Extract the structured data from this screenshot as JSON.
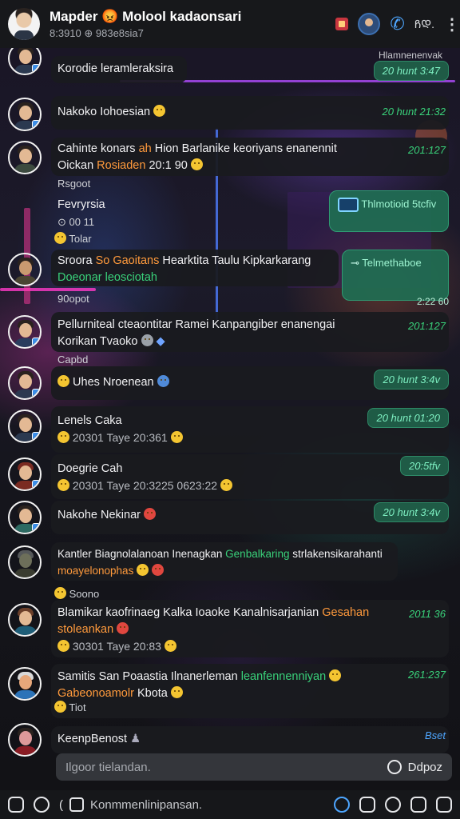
{
  "header": {
    "title": "Mapder 😡 Molool kadaonsari",
    "subtitle": "8:3910 ⊕ 983e8sia7",
    "video_label": "ᲩᲓ.",
    "menu": "⋮"
  },
  "top_strip": {
    "right_text": "Hlamnenenvak"
  },
  "messages": [
    {
      "text": "Korodie leramleraksira",
      "time": "20 hunt 3:47"
    },
    {
      "text": "Nakoko Iohoesian",
      "time": "20 hunt 21:32"
    },
    {
      "line1_a": "Cahinte konars ",
      "line1_b": "ah",
      "line1_c": " Hion Barlanike keoriyans enanennit",
      "line2_a": "Oickan ",
      "line2_b": "Rosiaden",
      "line2_c": " 20:1 90",
      "time": "201:127"
    },
    {
      "label": "Rsgoot",
      "title": "Fevryrsia",
      "sub": "⊙ 00 11",
      "react": "Tolar",
      "card": "Thlmotioid 5tcfiv"
    },
    {
      "line1_a": "Sroora ",
      "line1_b": "So Gaoitans",
      "line1_c": " Hearktita Taulu Kipkarkarang",
      "line2": "Doeonar leosciotah",
      "label": "90opot",
      "card": "Telmethaboe",
      "card_time": "2:22 60"
    },
    {
      "line1": "Pellurniteal cteaontitar Ramei Kanpangiber enanengai",
      "line2": "Korikan Tvaoko",
      "label": "Capbd",
      "time": "201:127"
    },
    {
      "text": "Uhes Nroenean",
      "time": "20 hunt 3:4v"
    },
    {
      "title": "Lenels Caka",
      "sub": "20301 Taye  20:361",
      "time": "20 hunt 01:20"
    },
    {
      "title": "Doegrie Cah",
      "sub": "20301 Taye  20:3225  0623:22",
      "time": "20:5tfv"
    },
    {
      "text": "Nakohe Nekinar",
      "time": "20 hunt 3:4v"
    },
    {
      "line1_a": "Kantler Biagnolalanoan Inenagkan ",
      "line1_b": "Genbalkaring",
      "line1_c": " strlakensikarahanti",
      "line2": "moayelonophas",
      "react": "Soono"
    },
    {
      "line1_a": "Blamikar kaofrinaeg Kalka Ioaoke Kanalnisarjanian ",
      "line1_b": "Gesahan",
      "line2": "stoleankan",
      "sub": "30301 Taye  20:83",
      "time": "2011 36"
    },
    {
      "line1_a": "Samitis San Poaastia Ilnanerleman ",
      "line1_b": "leanfennenniyan",
      "line2": "Gabeonoamolr",
      "line2_b": "Kbota",
      "react": "Tiot",
      "time": "261:237"
    },
    {
      "text": "KeenpBenost",
      "time": "Bset"
    }
  ],
  "composer": {
    "placeholder": "Ilgoor tielandan.",
    "action_label": "Ddpoz"
  },
  "bottom_bar": {
    "placeholder": "Konmmenlinipansan."
  },
  "colors": {
    "accent_green": "#39d17a",
    "accent_orange": "#ff9a3c",
    "accent_blue": "#4ea6ff"
  }
}
